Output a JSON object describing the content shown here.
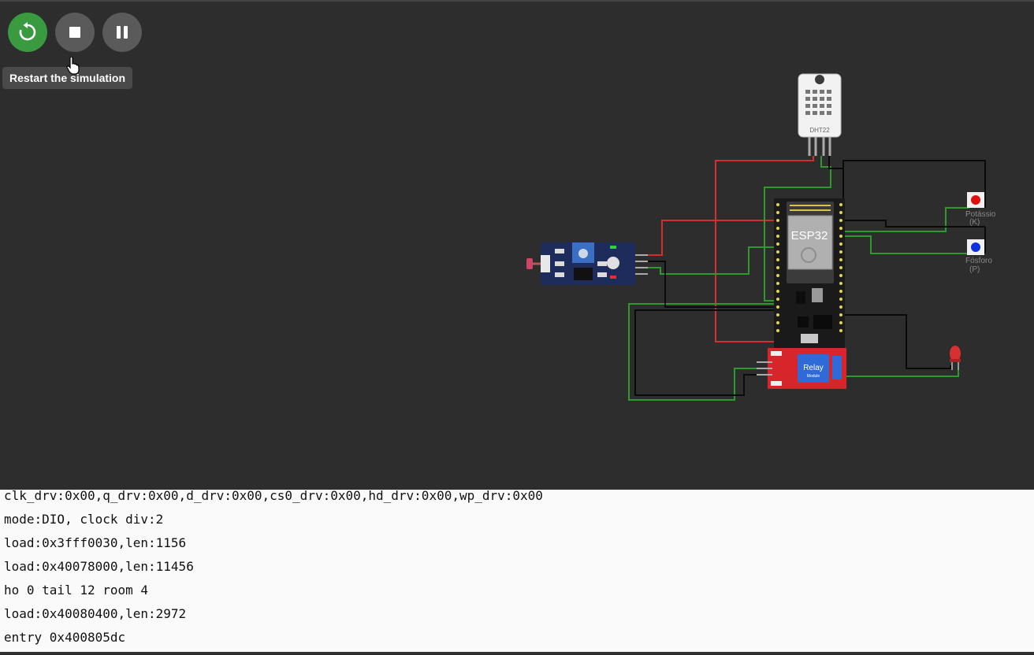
{
  "toolbar": {
    "restart_icon": "restart-icon",
    "stop_icon": "stop-icon",
    "pause_icon": "pause-icon",
    "tooltip": "Restart the simulation"
  },
  "circuit": {
    "esp32_label": "ESP32",
    "dht_label": "DHT22",
    "relay_label": "Relay",
    "relay_sub": "Module",
    "button1_label": "Potássio",
    "button1_sub": "(K)",
    "button2_label": "Fósforo",
    "button2_sub": "(P)",
    "colors": {
      "red_wire": "#d32f2f",
      "green_wire": "#2e9a2e",
      "black_wire": "#0a0a0a",
      "button_red": "#e01010",
      "button_blue": "#1030e0"
    }
  },
  "console": {
    "lines": [
      "clk_drv:0x00,q_drv:0x00,d_drv:0x00,cs0_drv:0x00,hd_drv:0x00,wp_drv:0x00",
      "mode:DIO, clock div:2",
      "load:0x3fff0030,len:1156",
      "load:0x40078000,len:11456",
      "ho 0 tail 12 room 4",
      "load:0x40080400,len:2972",
      "entry 0x400805dc"
    ]
  }
}
